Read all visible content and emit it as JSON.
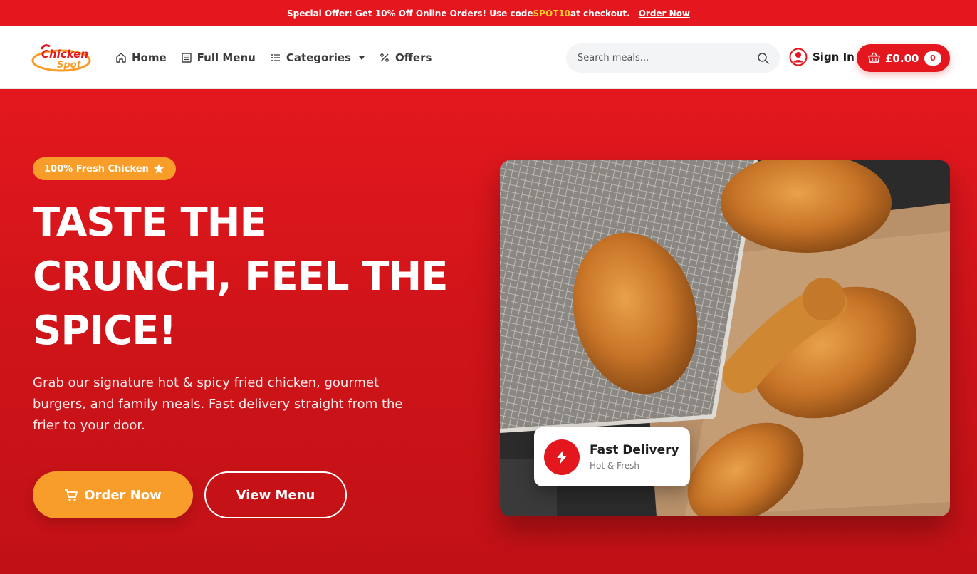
{
  "promo": {
    "text_before": "Special Offer: Get 10% Off Online Orders! Use code ",
    "code": "SPOT10",
    "text_after": " at checkout.",
    "link": "Order Now"
  },
  "brand": {
    "logo_line1": "Chicken",
    "logo_line2": "Spot"
  },
  "nav": {
    "items": [
      {
        "label": "Home",
        "icon": "home-icon"
      },
      {
        "label": "Full Menu",
        "icon": "menu-book-icon"
      },
      {
        "label": "Categories",
        "icon": "list-icon"
      },
      {
        "label": "Offers",
        "icon": "percent-icon"
      }
    ]
  },
  "search": {
    "placeholder": "Search meals...",
    "value": ""
  },
  "account": {
    "signin_label": "Sign In"
  },
  "cart": {
    "total": "£0.00",
    "count": "0"
  },
  "hero": {
    "badge": "100% Fresh Chicken",
    "headline": "TASTE THE CRUNCH, FEEL THE SPICE!",
    "subtext": "Grab our signature hot & spicy fried chicken, gourmet burgers, and family meals. Fast delivery straight from the frier to your door.",
    "order_button": "Order Now",
    "menu_button": "View Menu",
    "card_title": "Fast Delivery",
    "card_subtitle": "Hot & Fresh"
  },
  "colors": {
    "brand_red": "#e4171e",
    "accent_orange": "#f89d2a",
    "promo_code_yellow": "#ffc629"
  }
}
